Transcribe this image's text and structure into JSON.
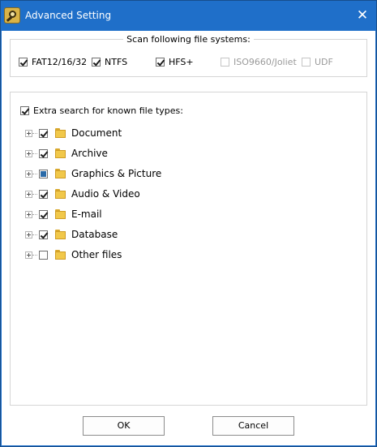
{
  "window": {
    "title": "Advanced Setting",
    "close_glyph": "✕"
  },
  "filesystems": {
    "legend": "Scan following file systems:",
    "items": [
      {
        "label": "FAT12/16/32",
        "checked": true,
        "enabled": true
      },
      {
        "label": "NTFS",
        "checked": true,
        "enabled": true
      },
      {
        "label": "HFS+",
        "checked": true,
        "enabled": true
      },
      {
        "label": "ISO9660/Joliet",
        "checked": false,
        "enabled": false
      },
      {
        "label": "UDF",
        "checked": false,
        "enabled": false
      }
    ]
  },
  "filetypes": {
    "master_label": "Extra search for known file types:",
    "master_checked": true,
    "items": [
      {
        "label": "Document",
        "state": "checked"
      },
      {
        "label": "Archive",
        "state": "checked"
      },
      {
        "label": "Graphics & Picture",
        "state": "partial"
      },
      {
        "label": "Audio & Video",
        "state": "checked"
      },
      {
        "label": "E-mail",
        "state": "checked"
      },
      {
        "label": "Database",
        "state": "checked"
      },
      {
        "label": "Other files",
        "state": "unchecked"
      }
    ]
  },
  "buttons": {
    "ok": "OK",
    "cancel": "Cancel"
  },
  "colors": {
    "titlebar": "#1f6fc9",
    "folder": "#f1c84a"
  }
}
